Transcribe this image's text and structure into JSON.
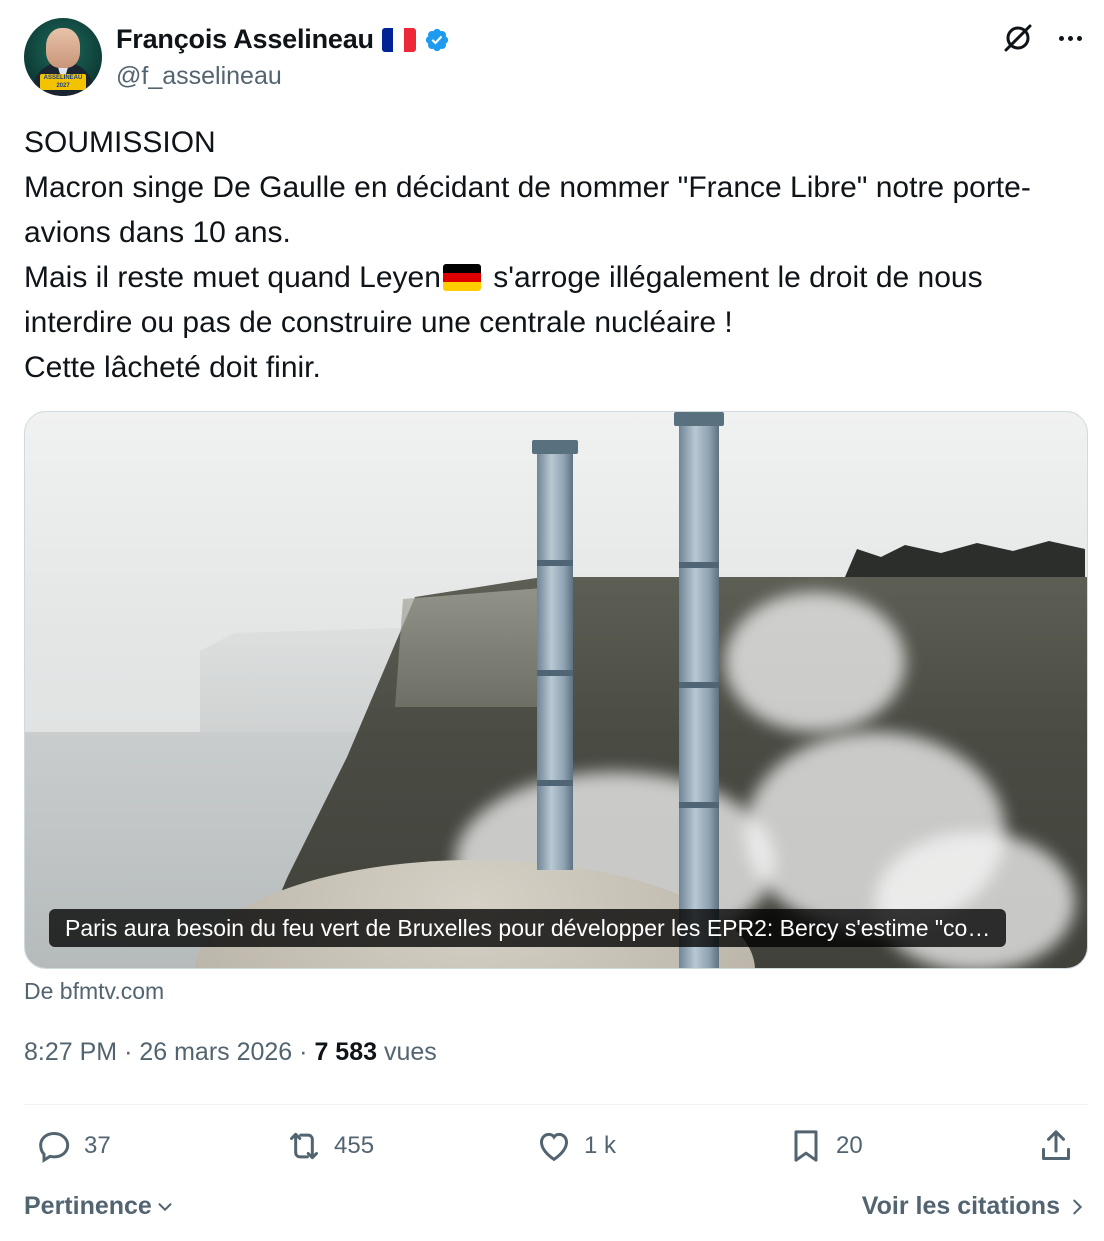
{
  "author": {
    "display_name": "François Asselineau",
    "handle": "@f_asselineau",
    "avatar_badge_text": "ASSELINEAU 2027",
    "verified": true
  },
  "icons": {
    "grok": "grok-icon",
    "more": "more-icon",
    "verified": "verified-badge-icon",
    "reply": "reply-icon",
    "retweet": "retweet-icon",
    "like": "like-icon",
    "bookmark": "bookmark-icon",
    "share": "share-icon"
  },
  "tweet": {
    "line1": "SOUMISSION",
    "line2": "Macron singe De Gaulle en décidant de nommer \"France Libre\" notre porte-avions dans 10 ans.",
    "line3_before_flag": "Mais il reste muet quand Leyen",
    "line3_after_flag": " s'arroge illégalement le droit de nous interdire ou pas de construire une centrale nucléaire !",
    "line4": "Cette lâcheté doit finir."
  },
  "card": {
    "caption": "Paris aura besoin du feu vert de Bruxelles pour développer les EPR2: Bercy s'estime \"co…",
    "source": "De bfmtv.com"
  },
  "meta": {
    "time": "8:27 PM",
    "date": "26 mars 2026",
    "views_count": "7 583",
    "views_label": "vues"
  },
  "actions": {
    "replies": "37",
    "reposts": "455",
    "likes": "1 k",
    "bookmarks": "20"
  },
  "footer": {
    "sort_label": "Pertinence",
    "quotes_label": "Voir les citations"
  },
  "colors": {
    "text_primary": "#0f1419",
    "text_secondary": "#536471",
    "verified_blue": "#1d9bf0",
    "border": "#cfd9de"
  }
}
